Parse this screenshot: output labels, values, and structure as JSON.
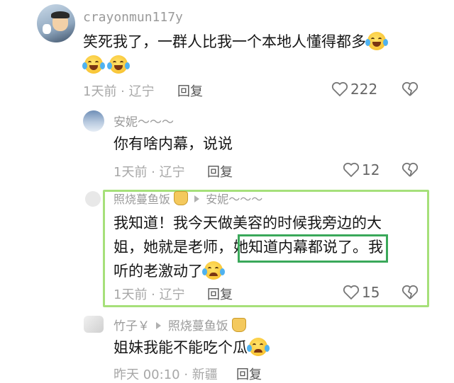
{
  "comments": [
    {
      "username": "crayonmun117y",
      "text": "笑死我了，一群人比我一个本地人懂得都多",
      "meta": "1天前 · 辽宁",
      "reply_label": "回复",
      "likes": "222"
    },
    {
      "username": "安妮～～～",
      "text": "你有啥内幕，说说",
      "meta": "1天前 · 辽宁",
      "reply_label": "回复",
      "likes": "12"
    },
    {
      "username": "照烧蔓鱼饭",
      "reply_to": "安妮～～～",
      "text_line1": "我知道！我今天做美容的时候我旁边的大",
      "text_line2_pre": "姐，她就是老师，",
      "text_highlight": "她知道内幕都说了。",
      "text_line2_post": "我",
      "text_line3": "听的老激动了",
      "meta": "1天前 · 辽宁",
      "reply_label": "回复",
      "likes": "15"
    },
    {
      "username": "竹子￥",
      "reply_to": "照烧蔓鱼饭",
      "text": "姐妹我能不能吃个瓜",
      "meta": "昨天 00:10 · 新疆",
      "reply_label": "回复"
    }
  ],
  "icons": {
    "like": "heart-outline-icon",
    "dislike": "broken-heart-icon",
    "emoji_laugh": "laughing-tears-emoji",
    "emoji_cry": "crying-emoji"
  },
  "colors": {
    "highlight_outer": "#a6e07a",
    "highlight_inner": "#3aa85a",
    "meta_gray": "#a7a7a7"
  }
}
